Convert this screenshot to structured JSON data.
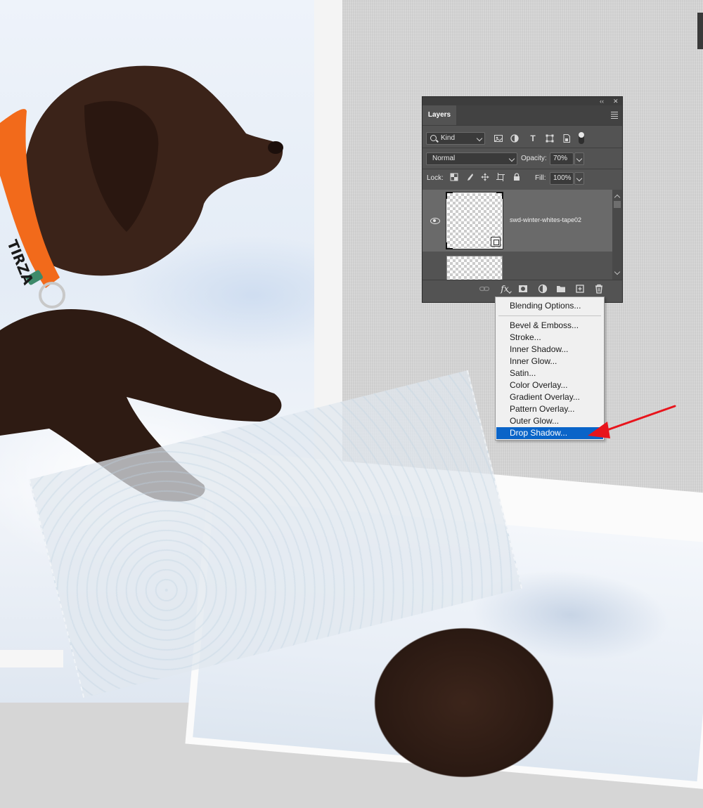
{
  "canvas": {
    "collar_text": "TIRZA"
  },
  "panel": {
    "tab": "Layers",
    "topbar": {
      "collapse": "‹‹",
      "close": "✕"
    },
    "filter": {
      "kind_label": "Kind",
      "icons": [
        "pixel-filter-icon",
        "adjustment-filter-icon",
        "type-filter-icon",
        "shape-filter-icon",
        "smart-object-filter-icon"
      ]
    },
    "blend": {
      "mode": "Normal",
      "opacity_label": "Opacity:",
      "opacity_value": "70%"
    },
    "lock": {
      "label": "Lock:",
      "fill_label": "Fill:",
      "fill_value": "100%"
    },
    "layers": [
      {
        "name": "swd-winter-whites-tape02",
        "visible": true,
        "selected": true
      },
      {
        "name": "",
        "visible": false,
        "selected": false
      }
    ],
    "bottom_icons": [
      "link-icon",
      "fx-icon",
      "mask-icon",
      "adjustment-icon",
      "folder-icon",
      "new-layer-icon",
      "trash-icon"
    ]
  },
  "fx_menu": {
    "items": [
      {
        "label": "Blending Options...",
        "selected": false
      },
      {
        "label": "Bevel & Emboss...",
        "selected": false
      },
      {
        "label": "Stroke...",
        "selected": false
      },
      {
        "label": "Inner Shadow...",
        "selected": false
      },
      {
        "label": "Inner Glow...",
        "selected": false
      },
      {
        "label": "Satin...",
        "selected": false
      },
      {
        "label": "Color Overlay...",
        "selected": false
      },
      {
        "label": "Gradient Overlay...",
        "selected": false
      },
      {
        "label": "Pattern Overlay...",
        "selected": false
      },
      {
        "label": "Outer Glow...",
        "selected": false
      },
      {
        "label": "Drop Shadow...",
        "selected": true
      }
    ],
    "highlight_color": "#0a64c8"
  },
  "annotation": {
    "arrow_color": "#e8141c"
  }
}
